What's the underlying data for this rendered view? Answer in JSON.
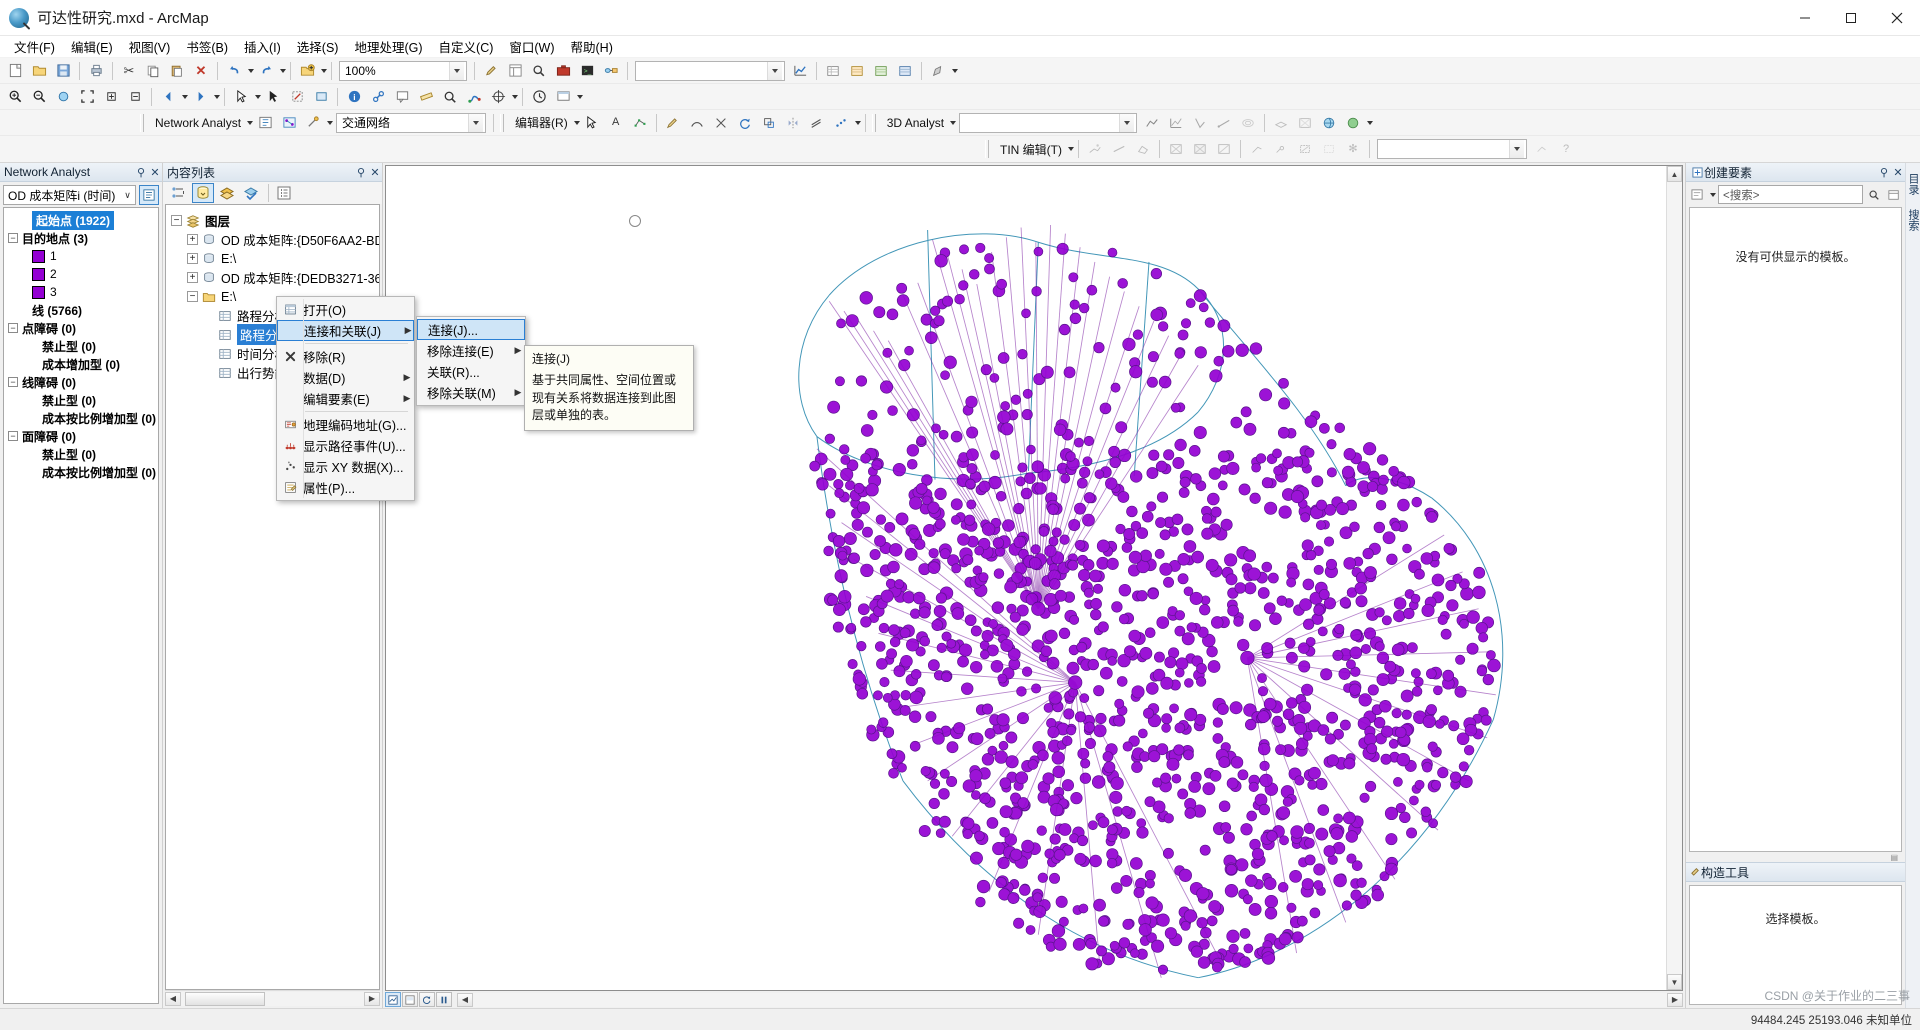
{
  "window": {
    "title": "可达性研究.mxd - ArcMap",
    "app_icon": "arcmap-globe-icon",
    "minimize": "−",
    "maximize": "☐",
    "close": "✕"
  },
  "menubar": {
    "items": [
      {
        "label": "文件(F)",
        "name": "menu-file"
      },
      {
        "label": "编辑(E)",
        "name": "menu-edit"
      },
      {
        "label": "视图(V)",
        "name": "menu-view"
      },
      {
        "label": "书签(B)",
        "name": "menu-bookmarks"
      },
      {
        "label": "插入(I)",
        "name": "menu-insert"
      },
      {
        "label": "选择(S)",
        "name": "menu-selection"
      },
      {
        "label": "地理处理(G)",
        "name": "menu-geoprocessing"
      },
      {
        "label": "自定义(C)",
        "name": "menu-customize"
      },
      {
        "label": "窗口(W)",
        "name": "menu-window"
      },
      {
        "label": "帮助(H)",
        "name": "menu-help"
      }
    ]
  },
  "toolbars": {
    "standard": {
      "zoom_value": "100%",
      "buttons": [
        "新建",
        "打开",
        "保存",
        "打印",
        "剪切",
        "复制",
        "粘贴",
        "删除",
        "撤销",
        "重做",
        "添加数据",
        "编辑器",
        "目录",
        "搜索",
        "ArcToolbox",
        "Python",
        "模型构建器"
      ]
    },
    "network_analyst": {
      "label": "Network Analyst",
      "dataset_value": "交通网络",
      "editor_label": "编辑器(R)",
      "threed_label": "3D Analyst",
      "threed_layer_value": "",
      "tin_label": "TIN 编辑(T)"
    }
  },
  "network_analyst_panel": {
    "title": "Network Analyst",
    "pin": "⚲",
    "close": "✕",
    "analysis_layer": "OD 成本矩阵i (时间)",
    "tree": [
      {
        "label": "起始点 (1922)",
        "indent": 1,
        "selected": true,
        "expander": "",
        "swatch": false
      },
      {
        "label": "目的地点 (3)",
        "indent": 0,
        "selected": false,
        "expander": "−",
        "swatch": false
      },
      {
        "label": "1",
        "indent": 1,
        "selected": false,
        "expander": "",
        "swatch": true
      },
      {
        "label": "2",
        "indent": 1,
        "selected": false,
        "expander": "",
        "swatch": true
      },
      {
        "label": "3",
        "indent": 1,
        "selected": false,
        "expander": "",
        "swatch": true
      },
      {
        "label": "线 (5766)",
        "indent": 1,
        "selected": false,
        "expander": "",
        "swatch": false
      },
      {
        "label": "点障碍 (0)",
        "indent": 0,
        "selected": false,
        "expander": "−",
        "swatch": false
      },
      {
        "label": "禁止型 (0)",
        "indent": 2,
        "selected": false,
        "expander": "",
        "swatch": false
      },
      {
        "label": "成本增加型 (0)",
        "indent": 2,
        "selected": false,
        "expander": "",
        "swatch": false
      },
      {
        "label": "线障碍 (0)",
        "indent": 0,
        "selected": false,
        "expander": "−",
        "swatch": false
      },
      {
        "label": "禁止型 (0)",
        "indent": 2,
        "selected": false,
        "expander": "",
        "swatch": false
      },
      {
        "label": "成本按比例增加型 (0)",
        "indent": 2,
        "selected": false,
        "expander": "",
        "swatch": false
      },
      {
        "label": "面障碍 (0)",
        "indent": 0,
        "selected": false,
        "expander": "−",
        "swatch": false
      },
      {
        "label": "禁止型 (0)",
        "indent": 2,
        "selected": false,
        "expander": "",
        "swatch": false
      },
      {
        "label": "成本按比例增加型 (0)",
        "indent": 2,
        "selected": false,
        "expander": "",
        "swatch": false
      }
    ]
  },
  "toc_panel": {
    "title": "内容列表",
    "pin": "⚲",
    "close": "✕",
    "toolbar_buttons": [
      {
        "name": "list-by-drawing-order-icon",
        "active": false
      },
      {
        "name": "list-by-source-icon",
        "active": true
      },
      {
        "name": "list-by-visibility-icon",
        "active": false
      },
      {
        "name": "list-by-selection-icon",
        "active": false
      },
      {
        "name": "options-icon",
        "active": false
      }
    ],
    "tree": [
      {
        "label": "图层",
        "indent": 0,
        "expander": "−",
        "icon": "layers-icon",
        "bold": true,
        "selected": false
      },
      {
        "label": "OD 成本矩阵:{D50F6AA2-BD",
        "indent": 1,
        "expander": "+",
        "icon": "dataset-icon",
        "bold": false,
        "selected": false
      },
      {
        "label": "E:\\",
        "indent": 1,
        "expander": "+",
        "icon": "dataset-icon",
        "bold": false,
        "selected": false
      },
      {
        "label": "OD 成本矩阵:{DEDB3271-36",
        "indent": 1,
        "expander": "+",
        "icon": "dataset-icon",
        "bold": false,
        "selected": false
      },
      {
        "label": "E:\\",
        "indent": 1,
        "expander": "−",
        "icon": "folder-icon",
        "bold": false,
        "selected": false
      },
      {
        "label": "路程分析_目的地",
        "indent": 2,
        "expander": "",
        "icon": "table-icon",
        "bold": false,
        "selected": false
      },
      {
        "label": "路程分析_线",
        "indent": 2,
        "expander": "",
        "icon": "table-icon",
        "bold": false,
        "selected": true
      },
      {
        "label": "时间分析",
        "indent": 2,
        "expander": "",
        "icon": "table-icon",
        "bold": false,
        "selected": false
      },
      {
        "label": "出行势能",
        "indent": 2,
        "expander": "",
        "icon": "table-icon",
        "bold": false,
        "selected": false
      }
    ]
  },
  "context_menu": {
    "items": [
      {
        "label": "打开(O)",
        "icon": "table-icon",
        "submenu": false,
        "highlighted": false,
        "name": "ctx-open"
      },
      {
        "label": "连接和关联(J)",
        "icon": "",
        "submenu": true,
        "highlighted": true,
        "name": "ctx-joins-relates"
      },
      {
        "label": "移除(R)",
        "icon": "remove-x-icon",
        "submenu": false,
        "highlighted": false,
        "name": "ctx-remove"
      },
      {
        "label": "数据(D)",
        "icon": "",
        "submenu": true,
        "highlighted": false,
        "name": "ctx-data"
      },
      {
        "label": "编辑要素(E)",
        "icon": "",
        "submenu": true,
        "highlighted": false,
        "name": "ctx-edit-features"
      },
      {
        "label": "地理编码地址(G)...",
        "icon": "geocode-icon",
        "submenu": false,
        "highlighted": false,
        "name": "ctx-geocode-addresses"
      },
      {
        "label": "显示路径事件(U)...",
        "icon": "route-events-icon",
        "submenu": false,
        "highlighted": false,
        "name": "ctx-display-route-events"
      },
      {
        "label": "显示 XY 数据(X)...",
        "icon": "xy-data-icon",
        "submenu": false,
        "highlighted": false,
        "name": "ctx-display-xy-data"
      },
      {
        "label": "属性(P)...",
        "icon": "properties-icon",
        "submenu": false,
        "highlighted": false,
        "name": "ctx-properties"
      }
    ]
  },
  "submenu": {
    "items": [
      {
        "label": "连接(J)...",
        "submenu": false,
        "highlighted": true,
        "name": "submenu-join"
      },
      {
        "label": "移除连接(E)",
        "submenu": true,
        "highlighted": false,
        "name": "submenu-remove-join"
      },
      {
        "label": "关联(R)...",
        "submenu": false,
        "highlighted": false,
        "name": "submenu-relate"
      },
      {
        "label": "移除关联(M)",
        "submenu": true,
        "highlighted": false,
        "name": "submenu-remove-relate"
      }
    ]
  },
  "tooltip": {
    "title": "连接(J)",
    "body": "基于共同属性、空间位置或现有关系将数据连接到此图层或单独的表。"
  },
  "right_panel": {
    "title": "创建要素",
    "pin": "⚲",
    "close": "✕",
    "search_placeholder": "<搜索>",
    "empty_message": "没有可供显示的模板。",
    "construction_tools_title": "构造工具",
    "construction_tools_message": "选择模板。",
    "vtabs": [
      "目录",
      "搜索"
    ]
  },
  "map": {
    "symbol_color": "#9400d3",
    "line_color": "#2e8bb0",
    "bottom_buttons": [
      "数据视图",
      "布局视图",
      "刷新",
      "暂停绘制"
    ]
  },
  "statusbar": {
    "coordinates": "94484.245  25193.046  未知单位"
  },
  "watermark": "CSDN @关于作业的二三事"
}
